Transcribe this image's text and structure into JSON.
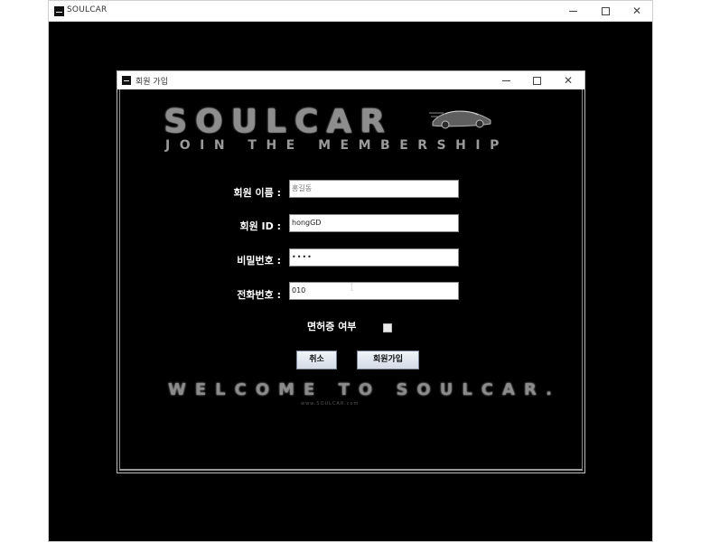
{
  "outer_window": {
    "title": "SOULCAR"
  },
  "dialog": {
    "title": "회원 가입",
    "logo": "SOULCAR",
    "subtitle": "JOIN THE MEMBERSHIP",
    "fields": [
      {
        "label": "회원 이름 :",
        "value": "홍길동",
        "is_placeholder": true
      },
      {
        "label": "회원 ID :",
        "value": "hongGD"
      },
      {
        "label": "비밀번호 :",
        "value": "••••"
      },
      {
        "label": "전화번호 :",
        "value": "010"
      }
    ],
    "license_label": "면허증 여부",
    "license_checked": false,
    "cancel_button": "취소",
    "signup_button": "회원가입",
    "welcome": "WELCOME TO SOULCAR.",
    "url_text": "www.SOULCAR.com"
  }
}
